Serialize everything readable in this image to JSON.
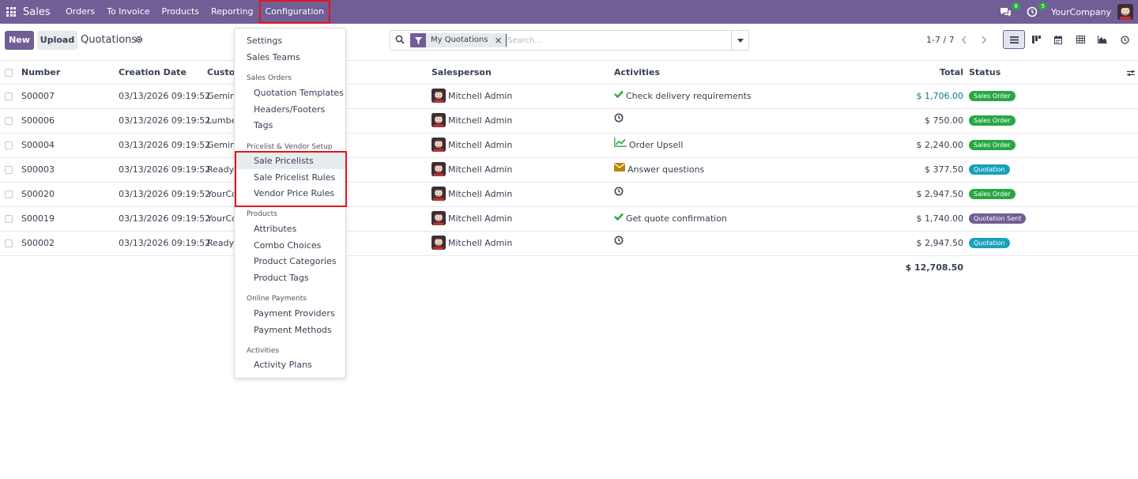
{
  "navbar": {
    "brand": "Sales",
    "menus": [
      "Orders",
      "To Invoice",
      "Products",
      "Reporting",
      "Configuration"
    ],
    "messages_count": "8",
    "activities_count": "5",
    "company": "YourCompany"
  },
  "control": {
    "new_label": "New",
    "upload_label": "Upload",
    "title": "Quotations"
  },
  "search": {
    "facet": "My Quotations",
    "placeholder": "Search..."
  },
  "pager": "1-7 / 7",
  "table": {
    "headers": {
      "number": "Number",
      "date": "Creation Date",
      "customer": "Customer",
      "salesperson": "Salesperson",
      "activities": "Activities",
      "total": "Total",
      "status": "Status"
    },
    "rows": [
      {
        "number": "S00007",
        "date": "03/13/2026 09:19:52",
        "customer": "Gemini",
        "salesperson": "Mitchell Admin",
        "activity": "Check delivery requirements",
        "activity_icon": "check-icon",
        "total": "$ 1,706.00",
        "status": "Sales Order"
      },
      {
        "number": "S00006",
        "date": "03/13/2026 09:19:52",
        "customer": "Lumber",
        "salesperson": "Mitchell Admin",
        "activity": "",
        "activity_icon": "clock-icon",
        "total": "$ 750.00",
        "status": "Sales Order"
      },
      {
        "number": "S00004",
        "date": "03/13/2026 09:19:52",
        "customer": "Gemini",
        "salesperson": "Mitchell Admin",
        "activity": "Order Upsell",
        "activity_icon": "chart-line-icon",
        "total": "$ 2,240.00",
        "status": "Sales Order"
      },
      {
        "number": "S00003",
        "date": "03/13/2026 09:19:52",
        "customer": "Ready M",
        "salesperson": "Mitchell Admin",
        "activity": "Answer questions",
        "activity_icon": "envelope-icon",
        "total": "$ 377.50",
        "status": "Quotation"
      },
      {
        "number": "S00020",
        "date": "03/13/2026 09:19:52",
        "customer": "YourCo",
        "salesperson": "Mitchell Admin",
        "activity": "",
        "activity_icon": "clock-icon",
        "total": "$ 2,947.50",
        "status": "Sales Order"
      },
      {
        "number": "S00019",
        "date": "03/13/2026 09:19:52",
        "customer": "YourCo",
        "salesperson": "Mitchell Admin",
        "activity": "Get quote confirmation",
        "activity_icon": "check-icon",
        "total": "$ 1,740.00",
        "status": "Quotation Sent"
      },
      {
        "number": "S00002",
        "date": "03/13/2026 09:19:52",
        "customer": "Ready M",
        "salesperson": "Mitchell Admin",
        "activity": "",
        "activity_icon": "clock-icon",
        "total": "$ 2,947.50",
        "status": "Quotation"
      }
    ],
    "grand_total": "$ 12,708.50"
  },
  "config_menu": {
    "settings": "Settings",
    "sales_teams": "Sales Teams",
    "sales_orders_header": "Sales Orders",
    "quotation_templates": "Quotation Templates",
    "headers_footers": "Headers/Footers",
    "tags": "Tags",
    "pricelist_header": "Pricelist & Vendor Setup",
    "sale_pricelists": "Sale Pricelists",
    "sale_pricelist_rules": "Sale Pricelist Rules",
    "vendor_price_rules": "Vendor Price Rules",
    "products_header": "Products",
    "attributes": "Attributes",
    "combo_choices": "Combo Choices",
    "product_categories": "Product Categories",
    "product_tags": "Product Tags",
    "online_payments_header": "Online Payments",
    "payment_providers": "Payment Providers",
    "payment_methods": "Payment Methods",
    "activities_header": "Activities",
    "activity_plans": "Activity Plans"
  },
  "colors": {
    "brand": "#715e96",
    "highlight_box": "#e3151b",
    "sales_order": "#28a745",
    "quotation": "#17a2b8",
    "quotation_sent": "#715e96",
    "link_total": "#017e84"
  }
}
